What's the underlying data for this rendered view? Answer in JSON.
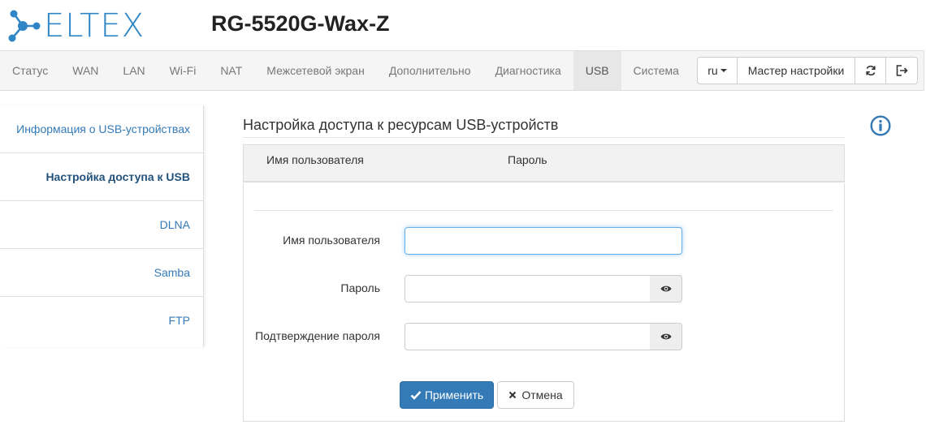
{
  "brand": {
    "logo_text": "ELTEX"
  },
  "device": {
    "model": "RG-5520G-Wax-Z"
  },
  "nav": {
    "items": [
      {
        "label": "Статус"
      },
      {
        "label": "WAN"
      },
      {
        "label": "LAN"
      },
      {
        "label": "Wi-Fi"
      },
      {
        "label": "NAT"
      },
      {
        "label": "Межсетевой экран"
      },
      {
        "label": "Дополнительно"
      },
      {
        "label": "Диагностика"
      },
      {
        "label": "USB",
        "active": true
      },
      {
        "label": "Система"
      }
    ],
    "language": "ru",
    "wizard_label": "Мастер настройки",
    "refresh_icon": "refresh-icon",
    "logout_icon": "logout-icon"
  },
  "sidebar": {
    "items": [
      {
        "label": "Информация о USB-устройствах"
      },
      {
        "label": "Настройка доступа к USB",
        "active": true
      },
      {
        "label": "DLNA"
      },
      {
        "label": "Samba"
      },
      {
        "label": "FTP"
      }
    ]
  },
  "main": {
    "title": "Настройка доступа к ресурсам USB-устройств",
    "info_icon": "info-icon",
    "table": {
      "columns": [
        "Имя пользователя",
        "Пароль"
      ],
      "rows": []
    },
    "form": {
      "username_label": "Имя пользователя",
      "username_value": "",
      "password_label": "Пароль",
      "password_value": "",
      "confirm_label": "Подтверждение пароля",
      "confirm_value": "",
      "show_password_icon": "eye-icon"
    },
    "buttons": {
      "apply": "Применить",
      "cancel": "Отмена"
    }
  },
  "colors": {
    "accent": "#337ab7",
    "logo": "#2f86c6",
    "navbar_bg": "#f5f5f5"
  }
}
